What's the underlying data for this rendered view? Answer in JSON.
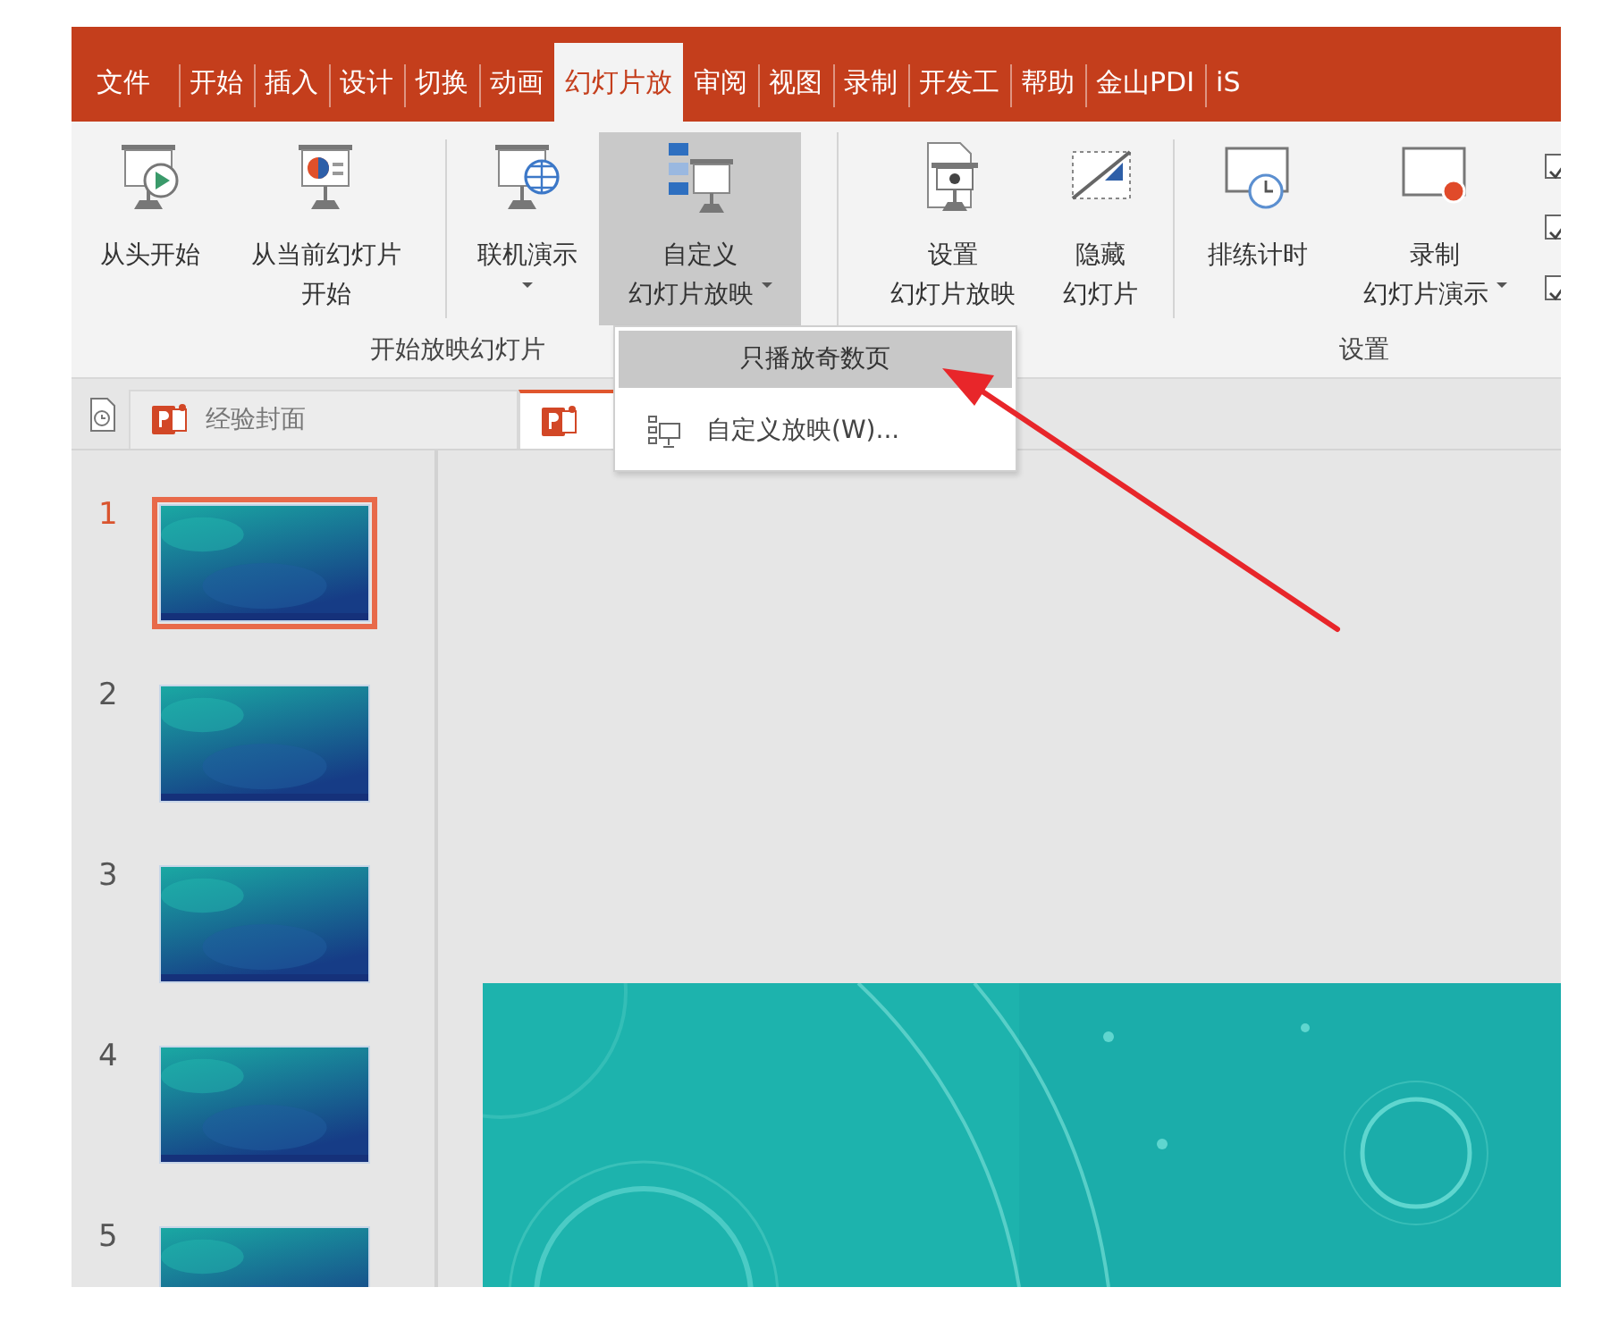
{
  "ribbon_tabs": [
    {
      "label": "文件",
      "selected": false
    },
    {
      "label": "开始",
      "selected": false
    },
    {
      "label": "插入",
      "selected": false
    },
    {
      "label": "设计",
      "selected": false
    },
    {
      "label": "切换",
      "selected": false
    },
    {
      "label": "动画",
      "selected": false
    },
    {
      "label": "幻灯片放",
      "selected": true
    },
    {
      "label": "审阅",
      "selected": false
    },
    {
      "label": "视图",
      "selected": false
    },
    {
      "label": "录制",
      "selected": false
    },
    {
      "label": "开发工",
      "selected": false
    },
    {
      "label": "帮助",
      "selected": false
    },
    {
      "label": "金山PDI",
      "selected": false
    },
    {
      "label": "iS",
      "selected": false
    }
  ],
  "ribbon": {
    "groups": [
      {
        "label": "开始放映幻灯片",
        "sections": [
          [
            {
              "label_lines": [
                "从头开始"
              ],
              "pressed": false,
              "has_dropdown": false
            },
            {
              "label_lines": [
                "从当前幻灯片",
                "开始"
              ],
              "pressed": false,
              "has_dropdown": false
            }
          ],
          [
            {
              "label_lines": [
                "联机演示"
              ],
              "pressed": false,
              "has_dropdown": true
            },
            {
              "label_lines": [
                "自定义",
                "幻灯片放映"
              ],
              "pressed": true,
              "has_dropdown": true
            }
          ]
        ]
      },
      {
        "label": "设置",
        "sections": [
          [
            {
              "label_lines": [
                "设置",
                "幻灯片放映"
              ],
              "pressed": false,
              "has_dropdown": false
            },
            {
              "label_lines": [
                "隐藏",
                "幻灯片"
              ],
              "pressed": false,
              "has_dropdown": false
            }
          ],
          [
            {
              "label_lines": [
                "排练计时"
              ],
              "pressed": false,
              "has_dropdown": false
            },
            {
              "label_lines": [
                "录制",
                "幻灯片演示"
              ],
              "pressed": false,
              "has_dropdown": true
            }
          ]
        ],
        "checkboxes": [
          {
            "checked": true
          },
          {
            "checked": true
          },
          {
            "checked": true
          }
        ]
      }
    ]
  },
  "dropdown_menu": {
    "items": [
      {
        "label": "只播放奇数页",
        "kind": "plain",
        "selected": true
      },
      {
        "label": "自定义放映(W)...",
        "kind": "icon",
        "selected": false
      }
    ]
  },
  "document_tabs": [
    {
      "label": "经验封面",
      "selected": false
    },
    {
      "selected": true
    }
  ],
  "slides": [
    {
      "number": "1",
      "selected": true
    },
    {
      "number": "2",
      "selected": false
    },
    {
      "number": "3",
      "selected": false
    },
    {
      "number": "4",
      "selected": false
    },
    {
      "number": "5",
      "selected": false
    }
  ]
}
